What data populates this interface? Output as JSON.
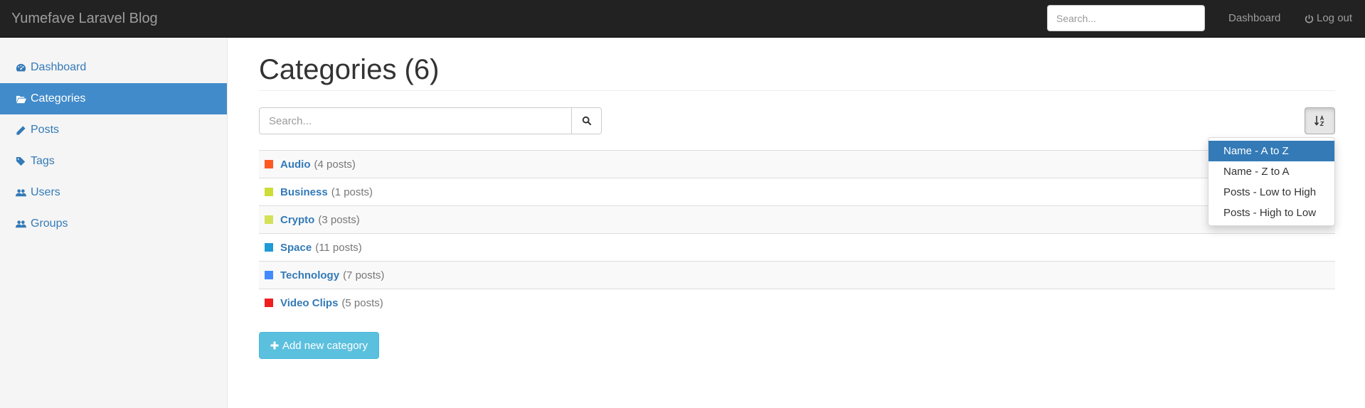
{
  "navbar": {
    "brand": "Yumefave Laravel Blog",
    "search_placeholder": "Search...",
    "dashboard_label": "Dashboard",
    "logout_label": "Log out"
  },
  "sidebar": {
    "items": [
      {
        "label": "Dashboard",
        "icon": "dashboard-icon",
        "active": false
      },
      {
        "label": "Categories",
        "icon": "folder-open-icon",
        "active": true
      },
      {
        "label": "Posts",
        "icon": "pencil-icon",
        "active": false
      },
      {
        "label": "Tags",
        "icon": "tags-icon",
        "active": false
      },
      {
        "label": "Users",
        "icon": "users-icon",
        "active": false
      },
      {
        "label": "Groups",
        "icon": "users-icon",
        "active": false
      }
    ]
  },
  "main": {
    "title": "Categories (6)",
    "search_placeholder": "Search...",
    "add_label": "Add new category"
  },
  "categories": [
    {
      "name": "Audio",
      "count": "(4 posts)",
      "color": "#ff5722"
    },
    {
      "name": "Business",
      "count": "(1 posts)",
      "color": "#cddc39"
    },
    {
      "name": "Crypto",
      "count": "(3 posts)",
      "color": "#d4e157"
    },
    {
      "name": "Space",
      "count": "(11 posts)",
      "color": "#1e9bd7"
    },
    {
      "name": "Technology",
      "count": "(7 posts)",
      "color": "#448aff"
    },
    {
      "name": "Video Clips",
      "count": "(5 posts)",
      "color": "#f01e1e"
    }
  ],
  "sort_menu": {
    "options": [
      "Name - A to Z",
      "Name - Z to A",
      "Posts - Low to High",
      "Posts - High to Low"
    ],
    "selected_index": 0
  }
}
